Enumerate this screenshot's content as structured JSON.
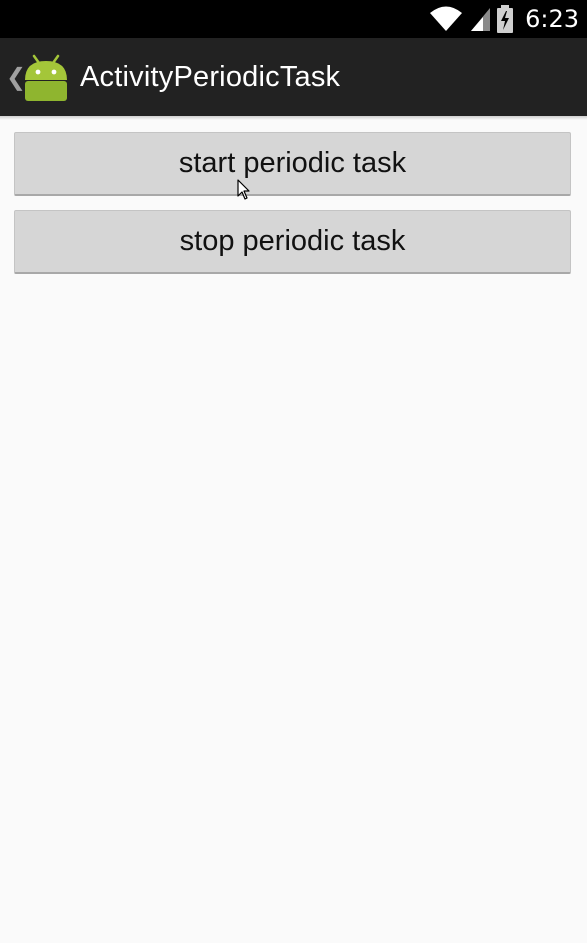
{
  "status_bar": {
    "time": "6:23",
    "icons": [
      "wifi-icon",
      "signal-icon",
      "battery-charging-icon"
    ]
  },
  "action_bar": {
    "title": "ActivityPeriodicTask",
    "back_icon": "chevron-left-icon",
    "app_icon": "android-robot-icon"
  },
  "buttons": {
    "start_label": "start periodic task",
    "stop_label": "stop periodic task"
  },
  "colors": {
    "status_bar_bg": "#000000",
    "action_bar_bg": "#222222",
    "content_bg": "#fafafa",
    "button_bg": "#d6d6d6",
    "android_green": "#a4c639"
  }
}
